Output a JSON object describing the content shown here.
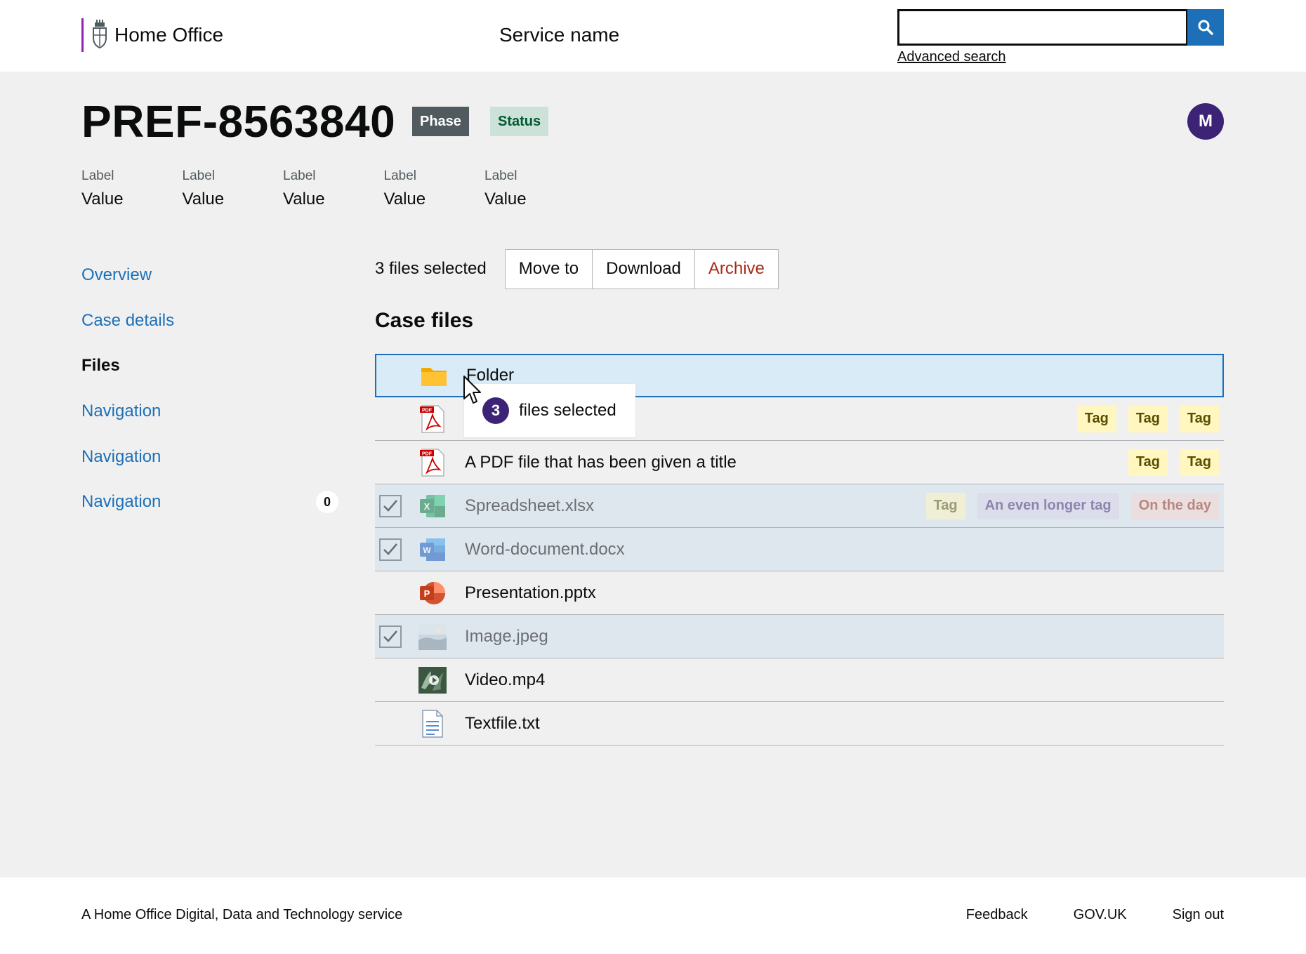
{
  "header": {
    "logo_text": "Home Office",
    "service_name": "Service name",
    "search_placeholder": "",
    "advanced_search": "Advanced search"
  },
  "case": {
    "reference": "PREF-8563840",
    "phase": "Phase",
    "status": "Status",
    "avatar_initial": "M",
    "summary": [
      {
        "label": "Label",
        "value": "Value"
      },
      {
        "label": "Label",
        "value": "Value"
      },
      {
        "label": "Label",
        "value": "Value"
      },
      {
        "label": "Label",
        "value": "Value"
      },
      {
        "label": "Label",
        "value": "Value"
      }
    ]
  },
  "sidenav": {
    "items": [
      {
        "label": "Overview"
      },
      {
        "label": "Case details"
      },
      {
        "label": "Files"
      },
      {
        "label": "Navigation"
      },
      {
        "label": "Navigation"
      },
      {
        "label": "Navigation",
        "count": "0"
      }
    ]
  },
  "actionbar": {
    "selected_text": "3 files selected",
    "move_to": "Move to",
    "download": "Download",
    "archive": "Archive"
  },
  "files": {
    "title": "Case files",
    "rows": [
      {
        "name": "Folder",
        "icon": "folder-icon"
      },
      {
        "name": "",
        "icon": "pdf-icon",
        "tags": [
          "Tag",
          "Tag",
          "Tag"
        ]
      },
      {
        "name": "A PDF file that has been given a title",
        "icon": "pdf-icon",
        "tags": [
          "Tag",
          "Tag"
        ]
      },
      {
        "name": "Spreadsheet.xlsx",
        "icon": "excel-icon",
        "selected": true,
        "tags": [
          "Tag",
          "An even longer tag",
          "On the day"
        ]
      },
      {
        "name": "Word-document.docx",
        "icon": "word-icon",
        "selected": true
      },
      {
        "name": "Presentation.pptx",
        "icon": "powerpoint-icon"
      },
      {
        "name": "Image.jpeg",
        "icon": "image-icon",
        "selected": true
      },
      {
        "name": "Video.mp4",
        "icon": "video-icon"
      },
      {
        "name": "Textfile.txt",
        "icon": "text-file-icon"
      }
    ]
  },
  "drag": {
    "count": "3",
    "text": "files selected"
  },
  "footer": {
    "meta": "A Home Office Digital, Data and Technology service",
    "feedback": "Feedback",
    "govuk": "GOV.UK",
    "signout": "Sign out"
  }
}
